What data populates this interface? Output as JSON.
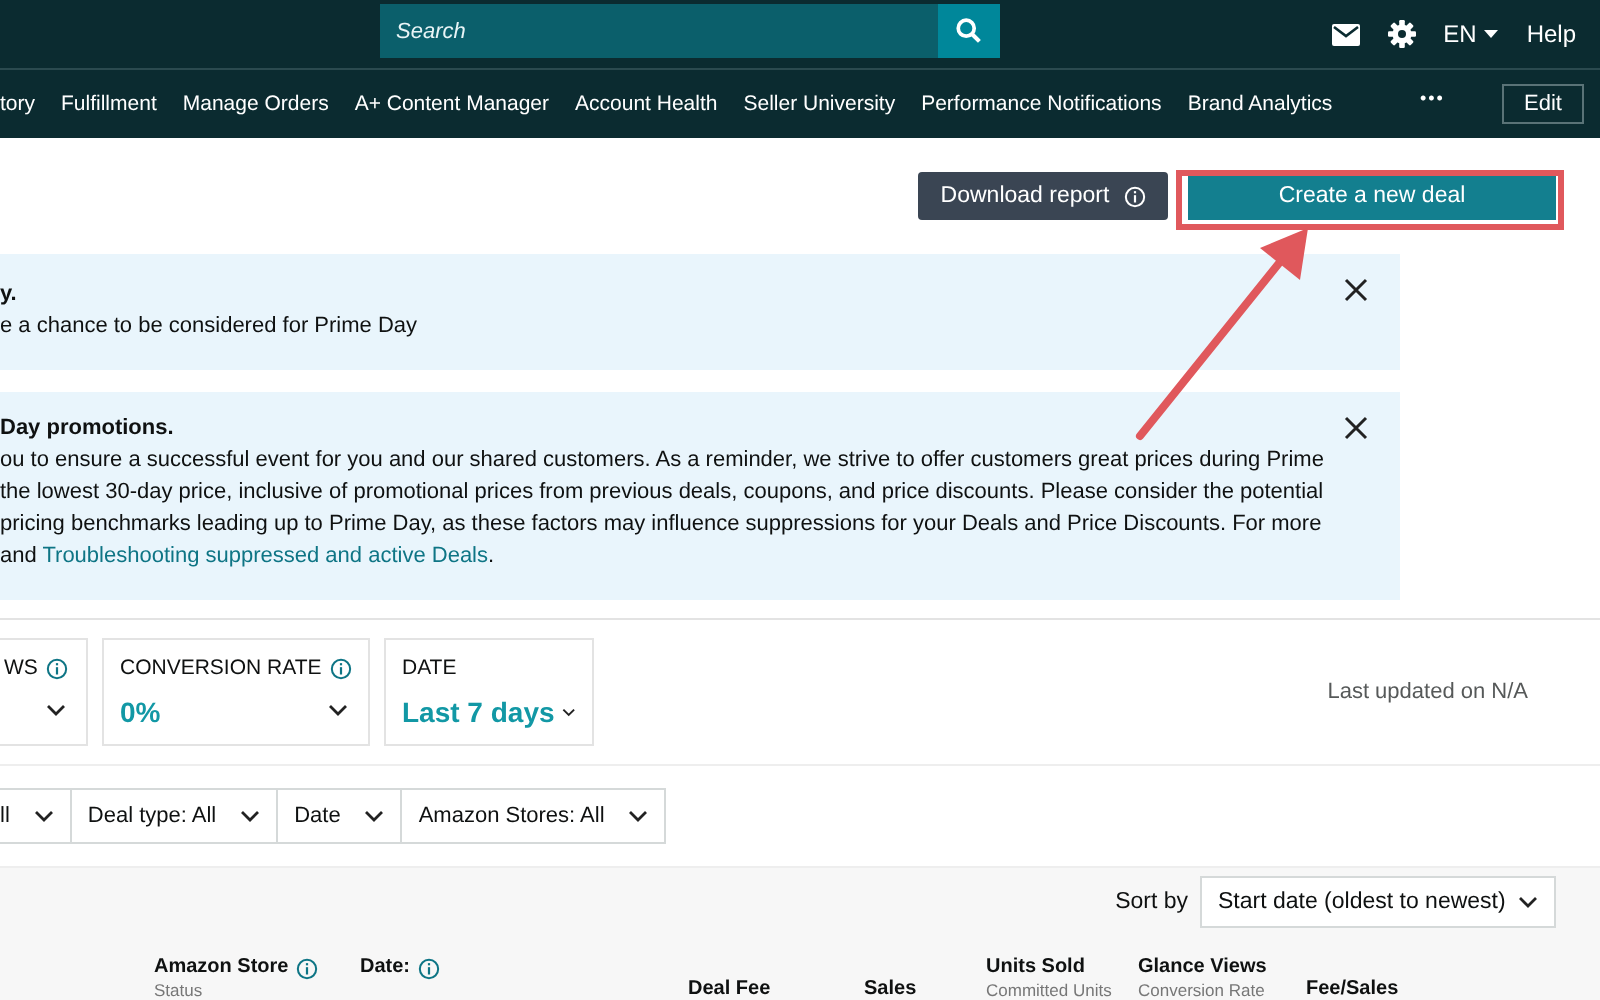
{
  "top_bar": {
    "search": {
      "placeholder": "Search"
    },
    "language": "EN",
    "help": "Help"
  },
  "nav": {
    "items": [
      "tory",
      "Fulfillment",
      "Manage Orders",
      "A+ Content Manager",
      "Account Health",
      "Seller University",
      "Performance Notifications",
      "Brand Analytics"
    ],
    "more": "•••",
    "edit": "Edit"
  },
  "actions": {
    "download": "Download report",
    "create": "Create a new deal"
  },
  "banners": [
    {
      "title": "y.",
      "lines": [
        "e a chance to be considered for Prime Day"
      ]
    },
    {
      "title": "Day promotions.",
      "lines": [
        "ou to ensure a successful event for you and our shared customers. As a reminder, we strive to offer customers great prices during Prime",
        "the lowest 30-day price, inclusive of promotional prices from previous deals, coupons, and price discounts. Please consider the potential",
        "pricing benchmarks leading up to Prime Day, as these factors may influence suppressions for your Deals and Price Discounts. For more",
        "and"
      ],
      "link": "Troubleshooting suppressed and active Deals",
      "link_after": "."
    }
  ],
  "metrics": [
    {
      "label": "WS",
      "info": true
    },
    {
      "label": "CONVERSION RATE",
      "info": true,
      "value": "0%"
    },
    {
      "label": "DATE",
      "info": false,
      "value": "Last 7 days"
    }
  ],
  "last_updated": "Last updated on N/A",
  "filters": [
    "ll",
    "Deal type: All",
    "Date",
    "Amazon Stores: All"
  ],
  "sort": {
    "label": "Sort by",
    "value": "Start date (oldest to newest)"
  },
  "table": {
    "columns": [
      {
        "label": "Amazon Store",
        "info": true,
        "sub": "Status"
      },
      {
        "label": "Date:",
        "info": true
      },
      {
        "label": "Deal Fee",
        "info": false
      },
      {
        "label": "Sales",
        "info": false
      },
      {
        "label": "Units Sold",
        "info": false,
        "sub": "Committed Units"
      },
      {
        "label": "Glance Views",
        "info": false,
        "sub": "Conversion Rate"
      },
      {
        "label": "Fee/Sales",
        "info": false
      }
    ]
  }
}
